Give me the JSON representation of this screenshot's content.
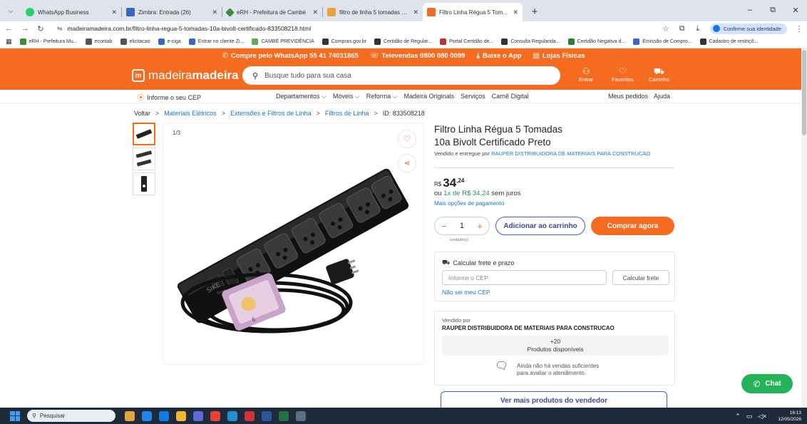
{
  "browser": {
    "tabs": [
      {
        "title": "WhatsApp Business",
        "color": "#25d366",
        "icon": "whatsapp-icon"
      },
      {
        "title": "Zimbra: Entrada (26)",
        "color": "#3a66c4",
        "icon": "mail-icon"
      },
      {
        "title": "eRH - Prefeitura de Cambé",
        "color": "#3c8d3c",
        "icon": "diamond-icon"
      },
      {
        "title": "filtro de linha 5 tomadas 10a c...",
        "color": "#e8a33b",
        "icon": "bag-icon"
      },
      {
        "title": "Filtro Linha Régua 5 Tomadas 1...",
        "color": "#f56b1f",
        "icon": "madeira-icon",
        "active": true
      }
    ],
    "new_tab": "+",
    "window_controls": {
      "minimize": "–",
      "restore": "⧉",
      "close": "✕"
    },
    "url": "madeiramadeira.com.br/filtro-linha-regua-5-tomadas-10a-bivolt-certificado-833508218.html",
    "profile_label": "Confirme sua identidade",
    "bookmarks": [
      {
        "label": "eRH - Prefeitura Mu...",
        "color": "#3c8d3c"
      },
      {
        "label": "econtab",
        "color": "#555"
      },
      {
        "label": "elicitacao",
        "color": "#555"
      },
      {
        "label": "e-ciga",
        "color": "#3a66c4"
      },
      {
        "label": "Entrar no cliente Zi...",
        "color": "#3a66c4"
      },
      {
        "label": "CAMBÉ PREVIDÊNCIA",
        "color": "#6aa84f"
      },
      {
        "label": "Compras.gov.br",
        "color": "#333"
      },
      {
        "label": "Certidão de Regular...",
        "color": "#333"
      },
      {
        "label": "Portal Certidão de...",
        "color": "#b33"
      },
      {
        "label": "Consulta Regularida...",
        "color": "#333"
      },
      {
        "label": "Certidão Negativa d...",
        "color": "#2e7d32"
      },
      {
        "label": "Emissão de Compro...",
        "color": "#3a66c4"
      },
      {
        "label": "Cadastro de restriçõ...",
        "color": "#333"
      }
    ]
  },
  "site": {
    "promo": {
      "whatsapp": "Compre pelo WhatsApp 55 41 74031865",
      "televendas": "Televendas 0800 080 0099",
      "app": "Baixe o App",
      "stores": "Lojas Físicas"
    },
    "logo_part1": "madeira",
    "logo_part2": "madeira",
    "search_placeholder": "Busque tudo para sua casa",
    "header_actions": {
      "login": "Entrar",
      "favorites": "Favoritos",
      "cart": "Carrinho"
    },
    "cep_prompt": "Informe o seu CEP",
    "menu": [
      "Departamentos ⌵",
      "Móveis ⌵",
      "Reforma ⌵",
      "Madeira Originals",
      "Serviços",
      "Carnê Digital"
    ],
    "orders": "Meus pedidos",
    "help": "Ajuda"
  },
  "breadcrumb": {
    "back": "Voltar",
    "items": [
      "Materiais Elétricos",
      "Extensões e Filtros de Linha",
      "Filtros de Linha"
    ],
    "id": "ID: 833508218",
    "sep": ">"
  },
  "gallery": {
    "counter": "1/3"
  },
  "product": {
    "title_line1": "Filtro Linha Régua 5 Tomadas",
    "title_line2": "10a Bivolt Certificado Preto",
    "sold_by_prefix": "Vendido e entregue por",
    "seller": "RAUPER DISTRIBUIDORA DE MATERIAIS PARA CONSTRUCAO",
    "price_currency": "R$",
    "price_int": "34",
    "price_cents": ",24",
    "installment_prefix": "ou",
    "installment_value": "1x de R$ 34,24",
    "installment_suffix": "sem juros",
    "payment_options": "Mais opções de pagamento",
    "quantity": "1",
    "unit": "unidade(s)",
    "add_to_cart": "Adicionar ao carrinho",
    "buy_now": "Comprar agora"
  },
  "shipping": {
    "title": "Calcular frete e prazo",
    "cep_placeholder": "Informe o CEP",
    "calc_button": "Calcular frete",
    "no_cep": "Não sei meu CEP"
  },
  "vendor": {
    "label": "Vendido por",
    "name": "RAUPER DISTRIBUIDORA DE MATERIAIS PARA CONSTRUCAO",
    "stock_count": "+20",
    "stock_label": "Produtos disponíveis",
    "no_sales_line1": "Ainda não há vendas suficientes",
    "no_sales_line2": "para avaliar o atendimento.",
    "more_products": "Ver mais produtos do vendedor"
  },
  "chat_label": "Chat",
  "taskbar": {
    "search_placeholder": "Pesquisar",
    "time": "16:13",
    "date": "12/05/2026",
    "apps": [
      "#e8a33b",
      "#1e88e5",
      "#0f7ae5",
      "#f2b632",
      "#5b6bd6",
      "#e94235",
      "#1f8fd6",
      "#d13438",
      "#2b579a",
      "#217346",
      "#5c7080"
    ]
  },
  "colors": {
    "brand": "#f56b1f",
    "link": "#1a73c8",
    "chat": "#25b35a"
  }
}
